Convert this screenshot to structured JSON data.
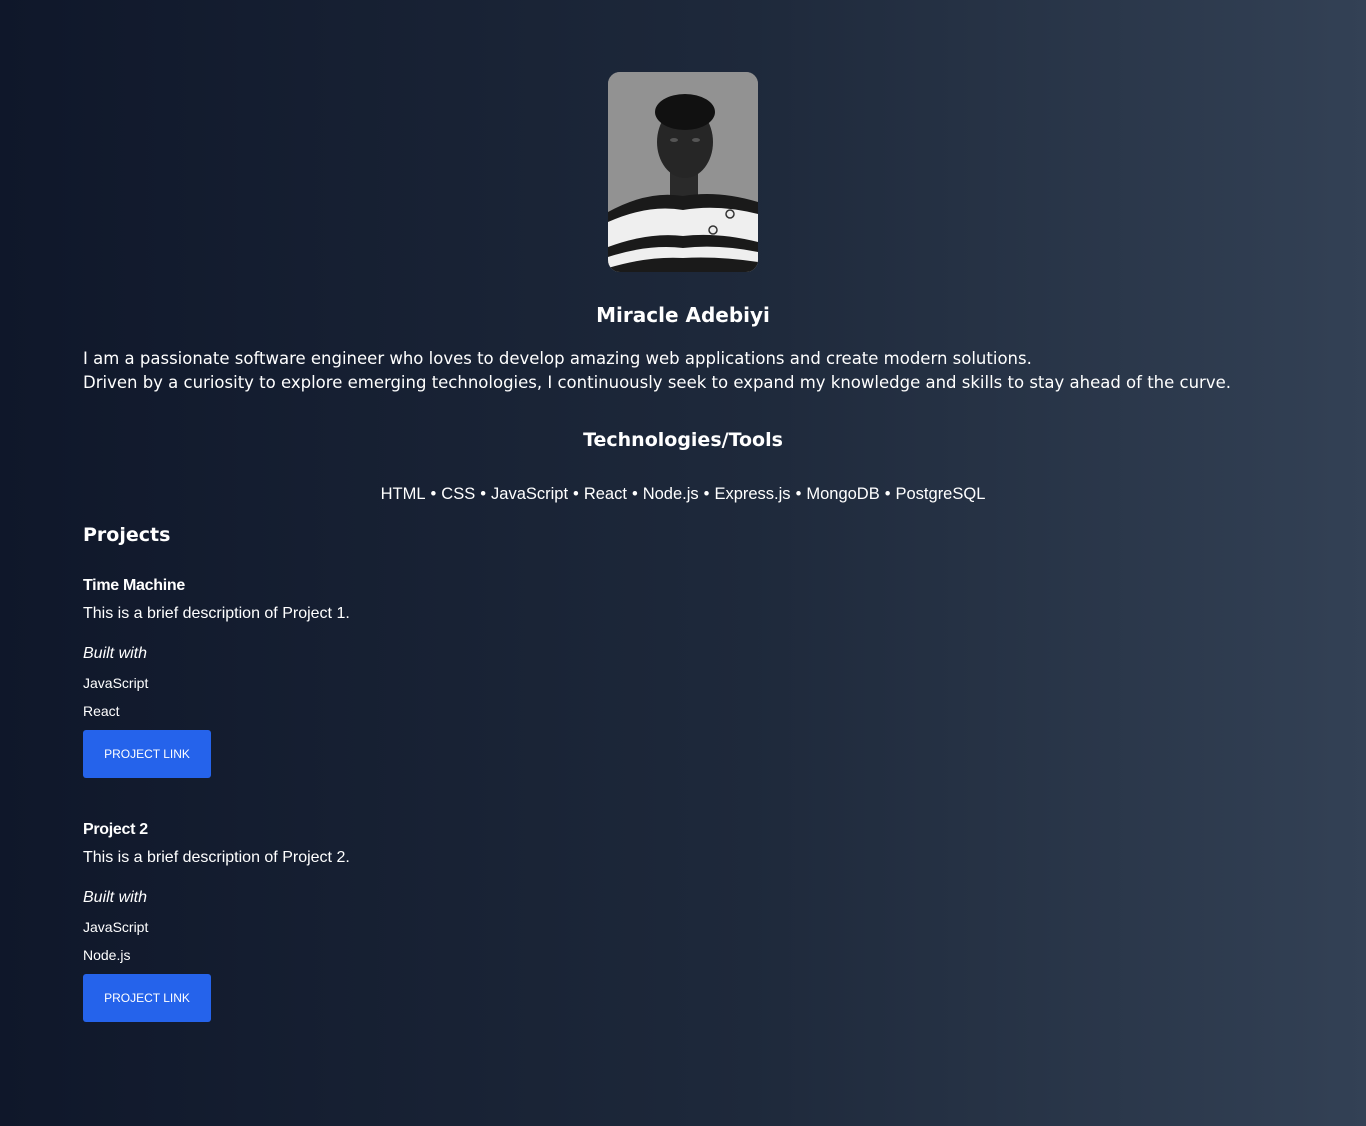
{
  "profile": {
    "name": "Miracle Adebiyi",
    "bio_lines": [
      "I am a passionate software engineer who loves to develop amazing web applications and create modern solutions.",
      "Driven by a curiosity to explore emerging technologies, I continuously seek to expand my knowledge and skills to stay ahead of the curve."
    ]
  },
  "technologies": {
    "heading": "Technologies/Tools",
    "separator": "•",
    "items": [
      "HTML",
      "CSS",
      "JavaScript",
      "React",
      "Node.js",
      "Express.js",
      "MongoDB",
      "PostgreSQL"
    ]
  },
  "projects": {
    "heading": "Projects",
    "items": [
      {
        "title": "Time Machine",
        "description": "This is a brief description of Project 1.",
        "built_with_label": "Built with",
        "tags": [
          "JavaScript",
          "React"
        ],
        "button_label": "PROJECT LINK"
      },
      {
        "title": "Project 2",
        "description": "This is a brief description of Project 2.",
        "built_with_label": "Built with",
        "tags": [
          "JavaScript",
          "Node.js"
        ],
        "button_label": "PROJECT LINK"
      }
    ]
  },
  "colors": {
    "background_start": "#0f172a",
    "background_end": "#334155",
    "button": "#2563eb",
    "text": "#ffffff"
  }
}
